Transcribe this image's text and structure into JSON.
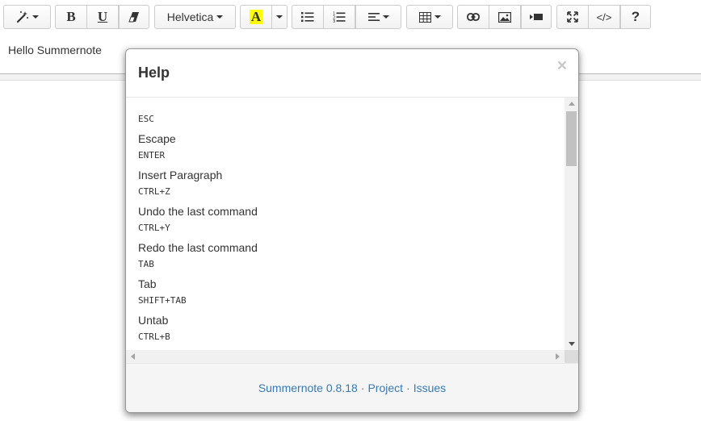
{
  "toolbar": {
    "style_icon": "magic-wand-icon",
    "bold_label": "B",
    "underline_label": "U",
    "clear_icon": "eraser-icon",
    "font_name": "Helvetica",
    "color_label": "A",
    "color_highlight": "#ffff00",
    "ul_icon": "unordered-list-icon",
    "ol_icon": "ordered-list-icon",
    "align_icon": "align-left-icon",
    "table_icon": "table-icon",
    "link_icon": "link-icon",
    "picture_icon": "picture-icon",
    "video_icon": "video-icon",
    "fullscreen_icon": "fullscreen-icon",
    "codeview_label": "</>",
    "help_label": "?"
  },
  "editor": {
    "content": "Hello Summernote"
  },
  "help_dialog": {
    "title": "Help",
    "close_label": "×",
    "shortcuts": [
      {
        "key": "ESC",
        "description": "Escape"
      },
      {
        "key": "ENTER",
        "description": "Insert Paragraph"
      },
      {
        "key": "CTRL+Z",
        "description": "Undo the last command"
      },
      {
        "key": "CTRL+Y",
        "description": "Redo the last command"
      },
      {
        "key": "TAB",
        "description": "Tab"
      },
      {
        "key": "SHIFT+TAB",
        "description": "Untab"
      },
      {
        "key": "CTRL+B",
        "description": ""
      }
    ],
    "footer": {
      "version_link": "Summernote 0.8.18",
      "project_link": "Project",
      "issues_link": "Issues",
      "separator": "·"
    }
  },
  "colors": {
    "link": "#337ab7",
    "footer_bg": "#f5f5f5",
    "toolbar_border": "#cccccc"
  }
}
